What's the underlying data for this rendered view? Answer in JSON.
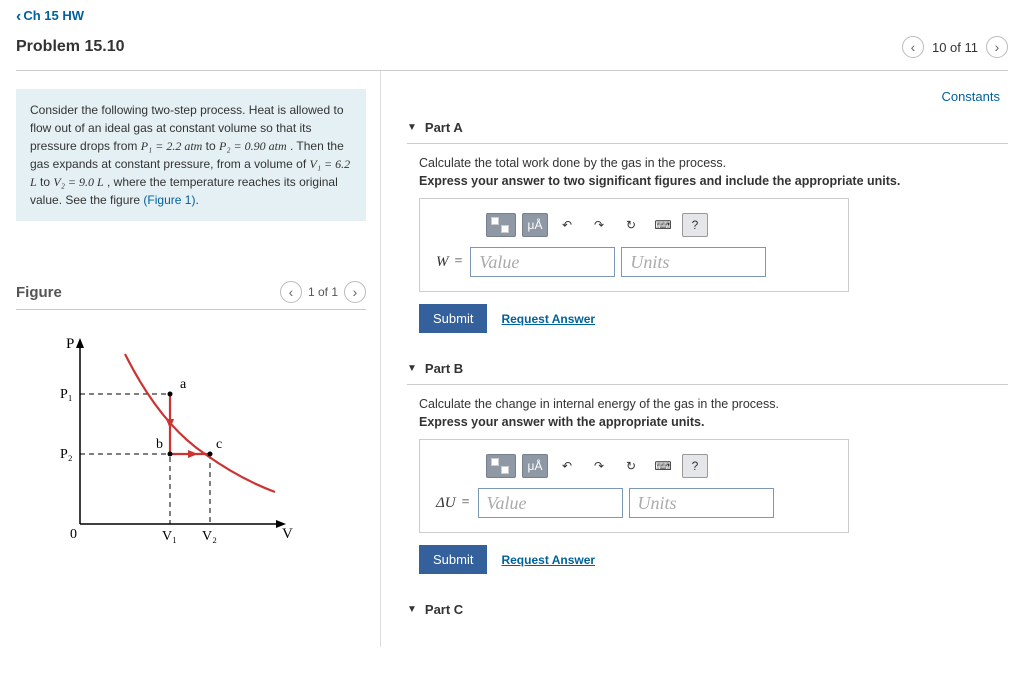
{
  "header": {
    "back_label": "Ch 15 HW",
    "title": "Problem 15.10",
    "progress": "10 of 11"
  },
  "problem": {
    "intro": "Consider the following two-step process. Heat is allowed to flow out of an ideal gas at constant volume so that its pressure drops from ",
    "p1": "P₁ = 2.2 atm",
    "to1": " to ",
    "p2": "P₂ = 0.90 atm",
    "mid": " . Then the gas expands at constant pressure, from a volume of ",
    "v1": "V₁ = 6.2 L",
    "to2": " to ",
    "v2": "V₂ = 9.0 L",
    "end": " , where the temperature reaches its original value. See the figure ",
    "figref": "(Figure 1)"
  },
  "figure": {
    "heading": "Figure",
    "counter": "1 of 1"
  },
  "constants": "Constants",
  "toolbar": {
    "mu": "μÅ",
    "undo": "↶",
    "redo": "↷",
    "reset": "↻",
    "help": "?"
  },
  "field": {
    "value_ph": "Value",
    "units_ph": "Units"
  },
  "partA": {
    "label": "Part A",
    "q": "Calculate the total work done by the gas in the process.",
    "instr": "Express your answer to two significant figures and include the appropriate units.",
    "var": "W",
    "submit": "Submit",
    "req": "Request Answer"
  },
  "partB": {
    "label": "Part B",
    "q": "Calculate the change in internal energy of the gas in the process.",
    "instr": "Express your answer with the appropriate units.",
    "var": "ΔU",
    "submit": "Submit",
    "req": "Request Answer"
  },
  "partC": {
    "label": "Part C"
  }
}
